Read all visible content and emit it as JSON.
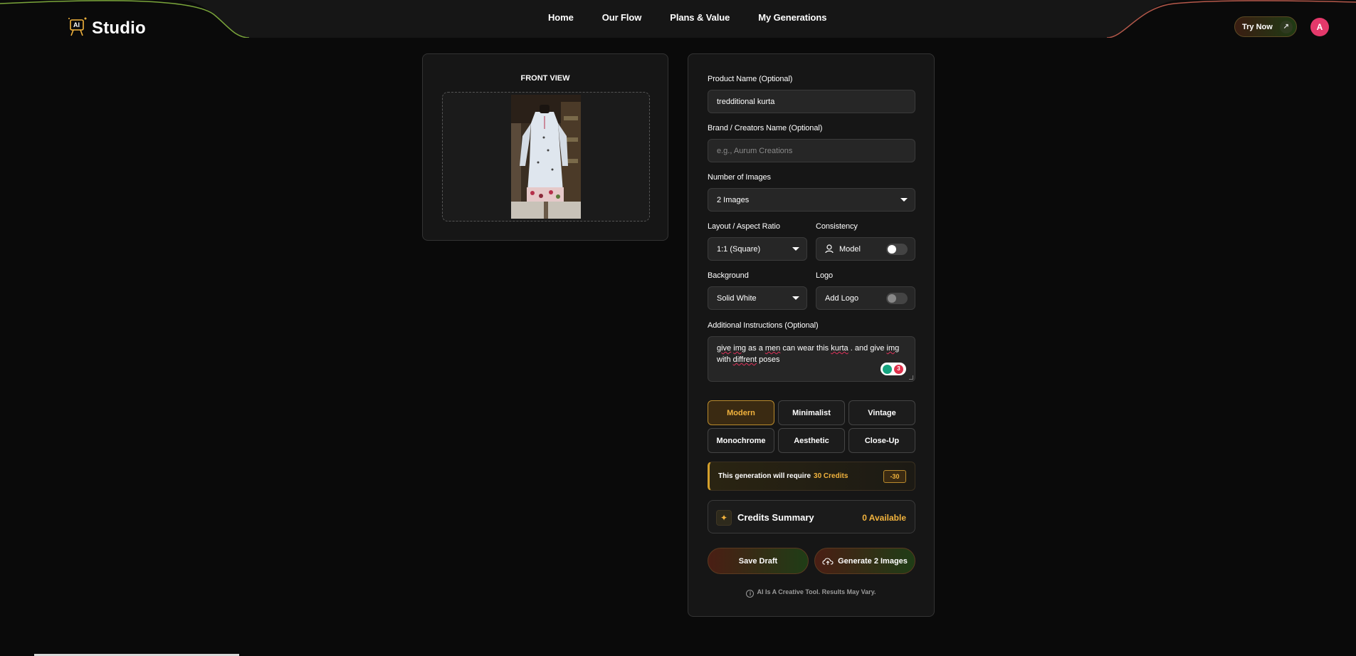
{
  "header": {
    "logo_badge": "AI",
    "logo_text": "Studio",
    "nav": [
      "Home",
      "Our Flow",
      "Plans & Value",
      "My Generations"
    ],
    "try_now": "Try Now",
    "avatar_initial": "A"
  },
  "preview": {
    "label": "FRONT VIEW"
  },
  "form": {
    "product_name": {
      "label": "Product Name (Optional)",
      "value": "tredditional kurta"
    },
    "brand_name": {
      "label": "Brand / Creators Name (Optional)",
      "placeholder": "e.g., Aurum Creations"
    },
    "num_images": {
      "label": "Number of Images",
      "value": "2 Images"
    },
    "layout": {
      "label": "Layout / Aspect Ratio",
      "value": "1:1 (Square)"
    },
    "consistency": {
      "label": "Consistency",
      "value": "Model",
      "enabled": false
    },
    "background": {
      "label": "Background",
      "value": "Solid White"
    },
    "logo": {
      "label": "Logo",
      "value": "Add Logo",
      "enabled": false
    },
    "instructions": {
      "label": "Additional Instructions (Optional)",
      "value": "give img as a men can wear this kurta . and give img with diffrent poses",
      "issue_count": "3"
    },
    "styles": [
      "Modern",
      "Minimalist",
      "Vintage",
      "Monochrome",
      "Aesthetic",
      "Close-Up"
    ],
    "selected_style": "Modern",
    "credit_note": {
      "text": "This generation will require",
      "credits": "30 Credits",
      "badge": "-30"
    },
    "summary": {
      "title": "Credits Summary",
      "available": "0 Available"
    },
    "save_draft": "Save Draft",
    "generate": "Generate 2 Images",
    "footnote": "AI Is A Creative Tool. Results May Vary."
  },
  "colors": {
    "accent": "#f2b33d",
    "avatar": "#e4396b",
    "background": "#0a0a0a",
    "card": "#161616"
  }
}
